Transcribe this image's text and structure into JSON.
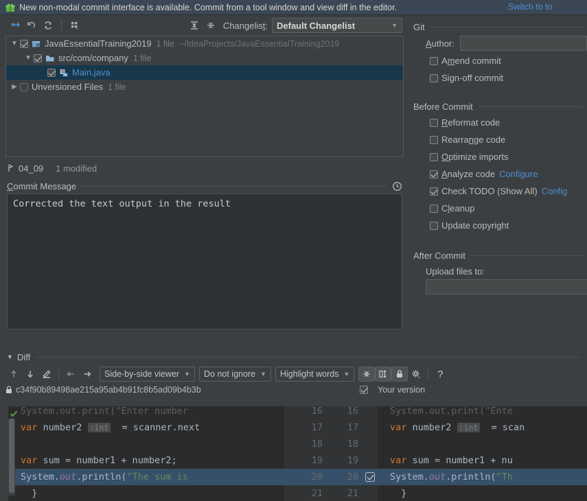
{
  "banner": {
    "icon": "gift-icon",
    "text": "New non-modal commit interface is available. Commit from a tool window and view diff in the editor.",
    "link": "Switch to to"
  },
  "toolbar": {
    "buttons": [
      {
        "name": "show-diff-icon",
        "tooltip": "Show Diff"
      },
      {
        "name": "revert-icon",
        "tooltip": "Revert"
      },
      {
        "name": "refresh-icon",
        "tooltip": "Refresh"
      },
      {
        "name": "group-by-icon",
        "tooltip": "Group By"
      },
      {
        "name": "expand-all-icon",
        "tooltip": "Expand All"
      },
      {
        "name": "collapse-all-icon",
        "tooltip": "Collapse All"
      }
    ],
    "changelist_label": "Changelist:",
    "changelist_mnemonic": "t",
    "changelist_value": "Default Changelist"
  },
  "tree": {
    "rows": [
      {
        "name": "project-node",
        "indent": 0,
        "twisty": "expanded",
        "checked": true,
        "icon": "module-icon",
        "label": "JavaEssentialTraining2019",
        "count": "1 file",
        "path": "~/IdeaProjects/JavaEssentialTraining2019",
        "selected": false,
        "link": false
      },
      {
        "name": "folder-node",
        "indent": 1,
        "twisty": "expanded",
        "checked": true,
        "icon": "folder-icon",
        "label": "src/com/company",
        "count": "1 file",
        "path": "",
        "selected": false,
        "link": false
      },
      {
        "name": "file-node",
        "indent": 2,
        "twisty": "none",
        "checked": true,
        "icon": "java-class-icon",
        "label": "Main.java",
        "count": "",
        "path": "",
        "selected": true,
        "link": true
      },
      {
        "name": "unversioned-node",
        "indent": 0,
        "twisty": "collapsed",
        "checked": false,
        "icon": "none",
        "label": "Unversioned Files",
        "count": "1 file",
        "path": "",
        "selected": false,
        "link": false
      }
    ]
  },
  "status": {
    "branch_icon": "branch-icon",
    "branch": "04_09",
    "modified": "1 modified"
  },
  "commit_message": {
    "title": "Commit Message",
    "title_mnemonic": "C",
    "history_icon": "clock-icon",
    "value": "Corrected the text output in the result",
    "placeholder": ""
  },
  "git_panel": {
    "title": "Git",
    "author_label": "Author:",
    "author_mnemonic": "A",
    "author_value": "",
    "options": [
      {
        "name": "amend-commit",
        "label_pre": "A",
        "label_mn": "m",
        "label_post": "end commit",
        "checked": false
      },
      {
        "name": "sign-off-commit",
        "label_pre": "Si",
        "label_mn": "g",
        "label_post": "n-off commit",
        "checked": false
      }
    ]
  },
  "before_commit": {
    "title": "Before Commit",
    "options": [
      {
        "name": "reformat-code",
        "label_pre": "",
        "label_mn": "R",
        "label_post": "eformat code",
        "checked": false,
        "link": ""
      },
      {
        "name": "rearrange-code",
        "label_pre": "Rearra",
        "label_mn": "n",
        "label_post": "ge code",
        "checked": false,
        "link": ""
      },
      {
        "name": "optimize-imports",
        "label_pre": "",
        "label_mn": "O",
        "label_post": "ptimize imports",
        "checked": false,
        "link": ""
      },
      {
        "name": "analyze-code",
        "label_pre": "",
        "label_mn": "A",
        "label_post": "nalyze code",
        "checked": true,
        "link": "Configure"
      },
      {
        "name": "check-todo",
        "label_pre": "Check TODO (Show All)",
        "label_mn": "",
        "label_post": "",
        "checked": true,
        "link": "Config"
      },
      {
        "name": "cleanup",
        "label_pre": "C",
        "label_mn": "l",
        "label_post": "eanup",
        "checked": false,
        "link": ""
      },
      {
        "name": "update-copyright",
        "label_pre": "Update copyright",
        "label_mn": "",
        "label_post": "",
        "checked": false,
        "link": ""
      }
    ]
  },
  "after_commit": {
    "title": "After Commit",
    "upload_label": "Upload files to:",
    "upload_value": ""
  },
  "diff": {
    "title": "Diff",
    "collapsed": false,
    "toolbar": {
      "buttons": [
        {
          "name": "previous-difference-icon",
          "glyph": "up-arrow"
        },
        {
          "name": "next-difference-icon",
          "glyph": "down-arrow"
        },
        {
          "name": "edit-source-icon",
          "glyph": "pencil"
        },
        {
          "name": "accept-left-icon",
          "glyph": "left-arrow"
        },
        {
          "name": "accept-right-icon",
          "glyph": "right-arrow"
        }
      ],
      "viewer_mode": "Side-by-side viewer",
      "ignore_policy": "Do not ignore",
      "highlight_policy": "Highlight words",
      "icon_buttons": [
        {
          "name": "collapse-unchanged-icon",
          "active": true
        },
        {
          "name": "synchronize-scrolling-icon",
          "active": true
        },
        {
          "name": "read-only-lock-icon",
          "active": true
        },
        {
          "name": "diff-settings-gear-icon",
          "active": false
        },
        {
          "name": "help-icon",
          "active": false
        }
      ]
    },
    "revision": {
      "lock_icon": "lock-icon",
      "hash": "c34f90b89498ae215a95ab4b91fc8b5ad09b4b3b",
      "your_version_label": "Your version",
      "your_version_checked": true
    },
    "gutter_lines": [
      {
        "left": "16",
        "right": "16",
        "checkbox": false,
        "highlight": false
      },
      {
        "left": "17",
        "right": "17",
        "checkbox": false,
        "highlight": false
      },
      {
        "left": "18",
        "right": "18",
        "checkbox": false,
        "highlight": false
      },
      {
        "left": "19",
        "right": "19",
        "checkbox": false,
        "highlight": false
      },
      {
        "left": "20",
        "right": "20",
        "checkbox": true,
        "highlight": true
      },
      {
        "left": "21",
        "right": "21",
        "checkbox": false,
        "highlight": false
      }
    ],
    "left_code": [
      "System.out.print(\"Enter number",
      "var number2 :int  = scanner.next",
      "",
      "var sum = number1 + number2;",
      "System.out.println(\"The sum is",
      "  }"
    ],
    "right_code": [
      "System.out.print(\"Ente",
      "var number2 :int  = scan",
      "",
      "var sum = number1 + nu",
      "System.out.println(\"Th",
      "  }"
    ],
    "inspection_icon": "inspection-ok-icon"
  },
  "colors": {
    "background": "#3c3f41",
    "banner_bg": "#3b4754",
    "link": "#4b8fd4",
    "selection": "#16374c",
    "diff_bg": "#2b2b2b",
    "diff_highlight": "#37506a",
    "gutter_bg": "#313335",
    "keyword": "#cc7832",
    "string": "#6a8759",
    "field": "#9876aa",
    "identifier": "#a9b7c6"
  }
}
